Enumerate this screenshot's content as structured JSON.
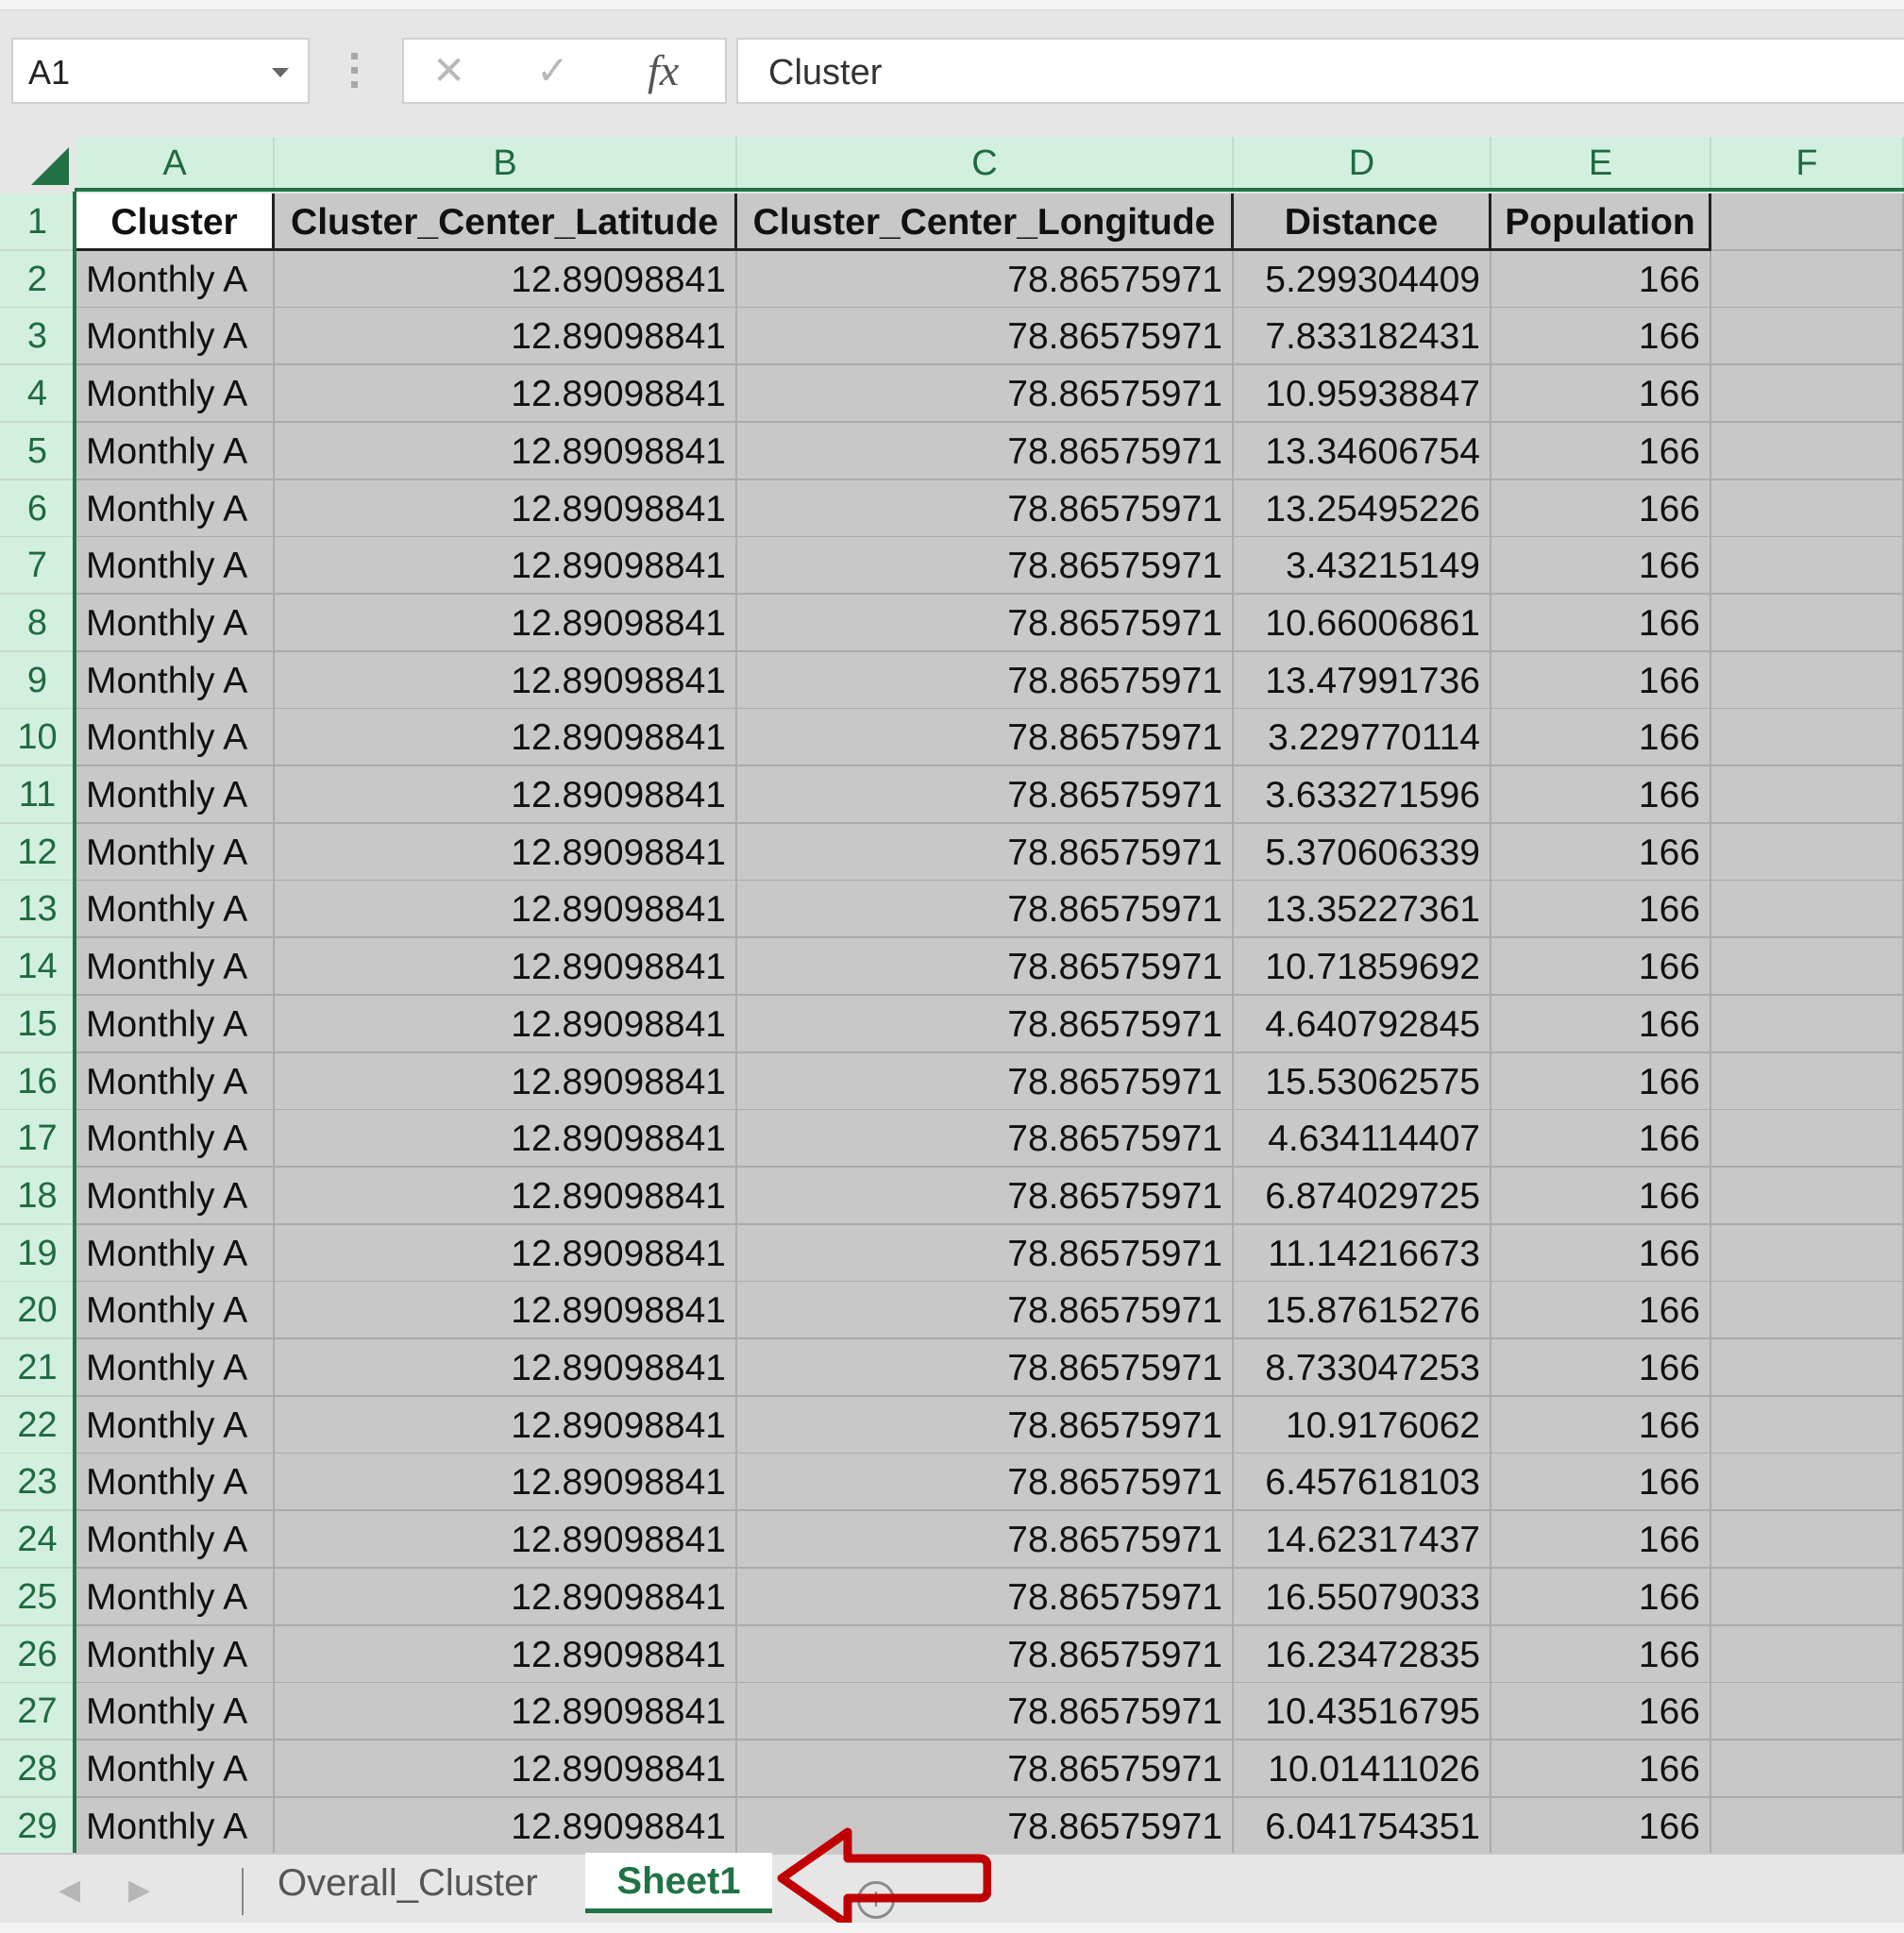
{
  "formula_bar": {
    "name_box": "A1",
    "cancel_icon": "cancel-icon",
    "enter_icon": "check-icon",
    "fx_label": "fx",
    "content": "Cluster"
  },
  "columns": [
    "A",
    "B",
    "C",
    "D",
    "E",
    "F"
  ],
  "header_row": [
    "Cluster",
    "Cluster_Center_Latitude",
    "Cluster_Center_Longitude",
    "Distance",
    "Population",
    ""
  ],
  "rows": [
    {
      "n": "2",
      "a": "Monthly A",
      "b": "12.89098841",
      "c": "78.86575971",
      "d": "5.299304409",
      "e": "166"
    },
    {
      "n": "3",
      "a": "Monthly A",
      "b": "12.89098841",
      "c": "78.86575971",
      "d": "7.833182431",
      "e": "166"
    },
    {
      "n": "4",
      "a": "Monthly A",
      "b": "12.89098841",
      "c": "78.86575971",
      "d": "10.95938847",
      "e": "166"
    },
    {
      "n": "5",
      "a": "Monthly A",
      "b": "12.89098841",
      "c": "78.86575971",
      "d": "13.34606754",
      "e": "166"
    },
    {
      "n": "6",
      "a": "Monthly A",
      "b": "12.89098841",
      "c": "78.86575971",
      "d": "13.25495226",
      "e": "166"
    },
    {
      "n": "7",
      "a": "Monthly A",
      "b": "12.89098841",
      "c": "78.86575971",
      "d": "3.43215149",
      "e": "166"
    },
    {
      "n": "8",
      "a": "Monthly A",
      "b": "12.89098841",
      "c": "78.86575971",
      "d": "10.66006861",
      "e": "166"
    },
    {
      "n": "9",
      "a": "Monthly A",
      "b": "12.89098841",
      "c": "78.86575971",
      "d": "13.47991736",
      "e": "166"
    },
    {
      "n": "10",
      "a": "Monthly A",
      "b": "12.89098841",
      "c": "78.86575971",
      "d": "3.229770114",
      "e": "166"
    },
    {
      "n": "11",
      "a": "Monthly A",
      "b": "12.89098841",
      "c": "78.86575971",
      "d": "3.633271596",
      "e": "166"
    },
    {
      "n": "12",
      "a": "Monthly A",
      "b": "12.89098841",
      "c": "78.86575971",
      "d": "5.370606339",
      "e": "166"
    },
    {
      "n": "13",
      "a": "Monthly A",
      "b": "12.89098841",
      "c": "78.86575971",
      "d": "13.35227361",
      "e": "166"
    },
    {
      "n": "14",
      "a": "Monthly A",
      "b": "12.89098841",
      "c": "78.86575971",
      "d": "10.71859692",
      "e": "166"
    },
    {
      "n": "15",
      "a": "Monthly A",
      "b": "12.89098841",
      "c": "78.86575971",
      "d": "4.640792845",
      "e": "166"
    },
    {
      "n": "16",
      "a": "Monthly A",
      "b": "12.89098841",
      "c": "78.86575971",
      "d": "15.53062575",
      "e": "166"
    },
    {
      "n": "17",
      "a": "Monthly A",
      "b": "12.89098841",
      "c": "78.86575971",
      "d": "4.634114407",
      "e": "166"
    },
    {
      "n": "18",
      "a": "Monthly A",
      "b": "12.89098841",
      "c": "78.86575971",
      "d": "6.874029725",
      "e": "166"
    },
    {
      "n": "19",
      "a": "Monthly A",
      "b": "12.89098841",
      "c": "78.86575971",
      "d": "11.14216673",
      "e": "166"
    },
    {
      "n": "20",
      "a": "Monthly A",
      "b": "12.89098841",
      "c": "78.86575971",
      "d": "15.87615276",
      "e": "166"
    },
    {
      "n": "21",
      "a": "Monthly A",
      "b": "12.89098841",
      "c": "78.86575971",
      "d": "8.733047253",
      "e": "166"
    },
    {
      "n": "22",
      "a": "Monthly A",
      "b": "12.89098841",
      "c": "78.86575971",
      "d": "10.9176062",
      "e": "166"
    },
    {
      "n": "23",
      "a": "Monthly A",
      "b": "12.89098841",
      "c": "78.86575971",
      "d": "6.457618103",
      "e": "166"
    },
    {
      "n": "24",
      "a": "Monthly A",
      "b": "12.89098841",
      "c": "78.86575971",
      "d": "14.62317437",
      "e": "166"
    },
    {
      "n": "25",
      "a": "Monthly A",
      "b": "12.89098841",
      "c": "78.86575971",
      "d": "16.55079033",
      "e": "166"
    },
    {
      "n": "26",
      "a": "Monthly A",
      "b": "12.89098841",
      "c": "78.86575971",
      "d": "16.23472835",
      "e": "166"
    },
    {
      "n": "27",
      "a": "Monthly A",
      "b": "12.89098841",
      "c": "78.86575971",
      "d": "10.43516795",
      "e": "166"
    },
    {
      "n": "28",
      "a": "Monthly A",
      "b": "12.89098841",
      "c": "78.86575971",
      "d": "10.01411026",
      "e": "166"
    },
    {
      "n": "29",
      "a": "Monthly A",
      "b": "12.89098841",
      "c": "78.86575971",
      "d": "6.041754351",
      "e": "166"
    }
  ],
  "sheet_tabs": {
    "tabs": [
      {
        "label": "Overall_Cluster",
        "active": false
      },
      {
        "label": "Sheet1",
        "active": true
      }
    ],
    "add_sheet_icon": "plus-circle-icon",
    "annotation": "red-arrow pointing at Sheet1 tab"
  },
  "colors": {
    "accent_green": "#217346",
    "header_bg": "#d3efe0",
    "selection_fill": "#c8c8c8",
    "annotation_red": "#c00000"
  }
}
